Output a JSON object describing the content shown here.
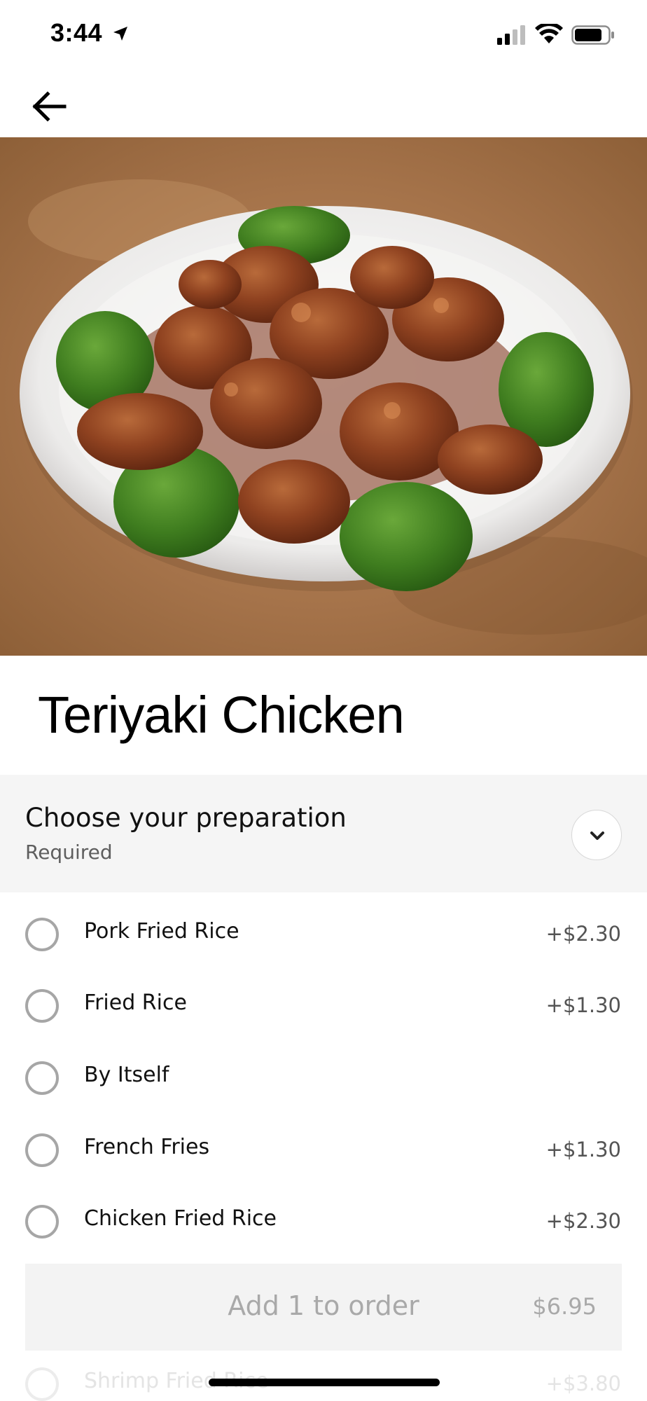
{
  "status_bar": {
    "time": "3:44",
    "icons": [
      "location-arrow-icon",
      "cellular-signal-icon",
      "wifi-icon",
      "battery-icon"
    ]
  },
  "nav": {
    "back_icon": "arrow-left-icon"
  },
  "hero_image": {
    "description_icon": "teriyaki-chicken-photo"
  },
  "item": {
    "title": "Teriyaki Chicken"
  },
  "preparation": {
    "title": "Choose your preparation",
    "subtitle": "Required",
    "toggle_icon": "chevron-down-icon",
    "options": [
      {
        "label": "Pork Fried Rice",
        "price": "+$2.30"
      },
      {
        "label": "Fried Rice",
        "price": "+$1.30"
      },
      {
        "label": "By Itself",
        "price": ""
      },
      {
        "label": "French Fries",
        "price": "+$1.30"
      },
      {
        "label": "Chicken Fried Rice",
        "price": "+$2.30"
      },
      {
        "label": "Shrimp Fried Rice",
        "price": "+$3.80"
      }
    ]
  },
  "order_button": {
    "label": "Add 1 to order",
    "price": "$6.95"
  },
  "colors": {
    "background": "#ffffff",
    "section_bg": "#f5f5f5",
    "radio_border": "#a6a6a6",
    "disabled_text": "#a9a9a9"
  }
}
